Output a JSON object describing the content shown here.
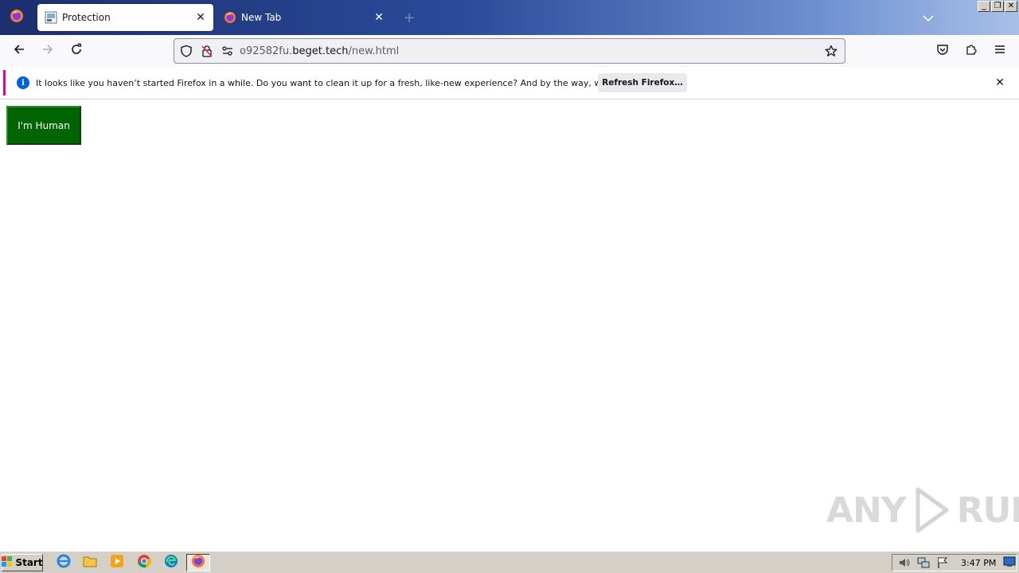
{
  "browser": {
    "tabs": [
      {
        "title": "Protection",
        "active": true
      },
      {
        "title": "New Tab",
        "active": false
      }
    ],
    "new_tab_symbol": "+",
    "url": {
      "prefix": "o92582fu.",
      "domain": "beget.tech",
      "path": "/new.html"
    }
  },
  "notification": {
    "info_glyph": "i",
    "message": "It looks like you haven’t started Firefox in a while. Do you want to clean it up for a fresh, like-new experience? And by the way, welcome back!",
    "button_label": "Refresh Firefox…"
  },
  "page": {
    "button_label": "I'm Human",
    "button_color": "#006400"
  },
  "watermark": {
    "left": "ANY",
    "right": "RUN"
  },
  "taskbar": {
    "start_label": "Start",
    "clock": "3:47 PM"
  },
  "colors": {
    "notice_accent": "#e7009a",
    "info_blue": "#0060df"
  }
}
